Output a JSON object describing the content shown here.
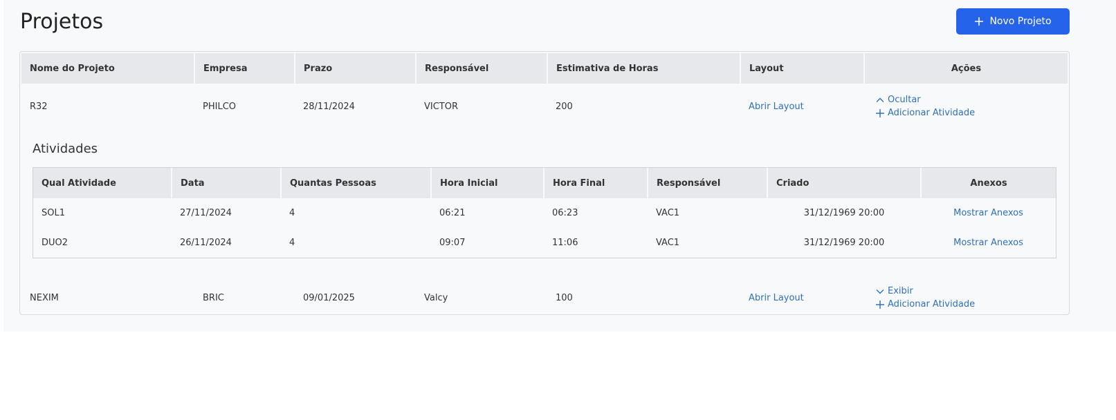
{
  "page": {
    "title": "Projetos"
  },
  "toolbar": {
    "new_project_label": "Novo Projeto"
  },
  "colors": {
    "primary": "#2563eb",
    "link": "#2f6fb6",
    "header_bg": "#e6e8ec"
  },
  "table": {
    "headers": [
      "Nome do Projeto",
      "Empresa",
      "Prazo",
      "Responsável",
      "Estimativa de Horas",
      "Layout",
      "Ações"
    ],
    "rows": [
      {
        "name": "R32",
        "company": "PHILCO",
        "deadline": "28/11/2024",
        "owner": "VICTOR",
        "hours": "200",
        "layout_link": "Abrir Layout",
        "toggle_label": "Ocultar",
        "add_activity_label": "Adicionar Atividade",
        "toggle_icon": "chevron-up-icon"
      },
      {
        "name": "NEXIM",
        "company": "BRIC",
        "deadline": "09/01/2025",
        "owner": "Valcy",
        "hours": "100",
        "layout_link": "Abrir Layout",
        "toggle_label": "Exibir",
        "add_activity_label": "Adicionar Atividade",
        "toggle_icon": "chevron-down-icon"
      }
    ]
  },
  "activities": {
    "title": "Atividades",
    "headers": [
      "Qual Atividade",
      "Data",
      "Quantas Pessoas",
      "Hora Inicial",
      "Hora Final",
      "Responsável",
      "Criado",
      "Anexos"
    ],
    "rows": [
      {
        "activity": "SOL1",
        "date": "27/11/2024",
        "people": "4",
        "start": "06:21",
        "end": "06:23",
        "owner": "VAC1",
        "created": "31/12/1969 20:00",
        "attachments": "Mostrar Anexos"
      },
      {
        "activity": "DUO2",
        "date": "26/11/2024",
        "people": "4",
        "start": "09:07",
        "end": "11:06",
        "owner": "VAC1",
        "created": "31/12/1969 20:00",
        "attachments": "Mostrar Anexos"
      }
    ]
  }
}
